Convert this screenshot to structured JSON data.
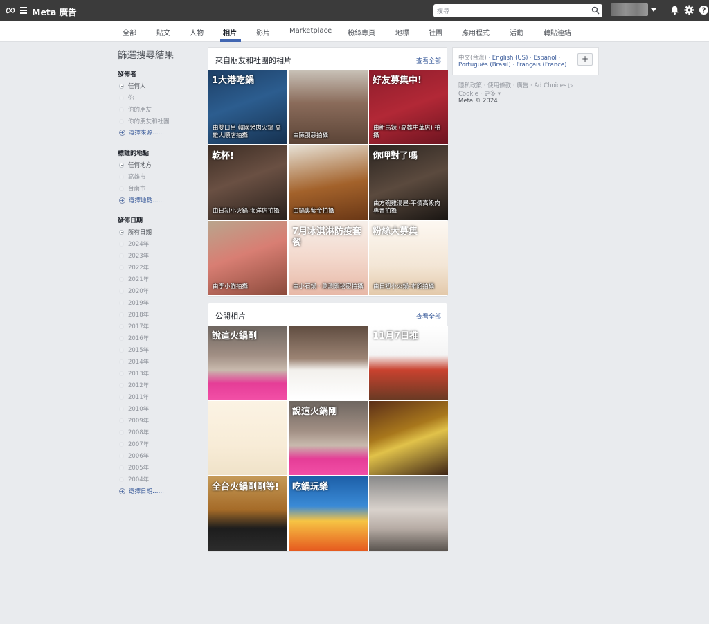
{
  "header": {
    "brand": "Meta 廣告",
    "search_placeholder": "搜尋",
    "icons": [
      "meta-logo-icon",
      "menu-icon",
      "search-icon",
      "bell-icon",
      "gear-icon",
      "help-icon"
    ]
  },
  "tabs": [
    "全部",
    "貼文",
    "人物",
    "相片",
    "影片",
    "Marketplace",
    "粉絲專頁",
    "地標",
    "社團",
    "應用程式",
    "活動",
    "轉貼連結"
  ],
  "active_tab": "相片",
  "filters": {
    "title": "篩選搜尋結果",
    "poster": {
      "heading": "發佈者",
      "options": [
        "任何人",
        "你",
        "你的朋友",
        "你的朋友和社團"
      ],
      "selected": "任何人",
      "more": "選擇來源……"
    },
    "location": {
      "heading": "標註的地點",
      "options": [
        "任何地方",
        "高雄市",
        "台南市"
      ],
      "selected": "任何地方",
      "more": "選擇地點……"
    },
    "date": {
      "heading": "發佈日期",
      "options": [
        "所有日期",
        "2024年",
        "2023年",
        "2022年",
        "2021年",
        "2020年",
        "2019年",
        "2018年",
        "2017年",
        "2016年",
        "2015年",
        "2014年",
        "2013年",
        "2012年",
        "2011年",
        "2010年",
        "2009年",
        "2008年",
        "2007年",
        "2006年",
        "2005年",
        "2004年"
      ],
      "selected": "所有日期",
      "more": "選擇日期……"
    }
  },
  "friends_section": {
    "title": "來自朋友和社團的相片",
    "see_all": "查看全部",
    "photos": [
      {
        "caption": "由雙口呂 韓國烤肉火鍋 高雄大順店拍攝",
        "overlay": "1大港吃鍋"
      },
      {
        "caption": "由陳韻慈拍攝",
        "overlay": ""
      },
      {
        "caption": "由新馬辣 (高雄中華店) 拍攝",
        "overlay": "好友募集中!"
      },
      {
        "caption": "由日初小火鍋-海洋店拍攝",
        "overlay": "乾杯!"
      },
      {
        "caption": "由鍋裏紫金拍攝",
        "overlay": ""
      },
      {
        "caption": "由方碗雞湯屋-平價高級肉專賣拍攝",
        "overlay": "你呷對了嗎"
      },
      {
        "caption": "由李小貓拍攝",
        "overlay": ""
      },
      {
        "caption": "由小石鍋 · 涮涮鍋秘密拍攝",
        "overlay": "7月冰淇淋防疫套餐"
      },
      {
        "caption": "由日初小火鍋-本館拍攝",
        "overlay": "粉絲大募集"
      }
    ]
  },
  "public_section": {
    "title": "公開相片",
    "see_all": "查看全部",
    "photos": [
      {
        "overlay": "說這火鍋剛"
      },
      {
        "overlay": ""
      },
      {
        "overlay": "11月7日推"
      },
      {
        "overlay": ""
      },
      {
        "overlay": "說這火鍋剛"
      },
      {
        "overlay": ""
      },
      {
        "overlay": "全台火鍋剛剛等!"
      },
      {
        "overlay": "吃鍋玩樂"
      },
      {
        "overlay": ""
      }
    ]
  },
  "languages": {
    "current": "中文(台灣)",
    "others": [
      "English (US)",
      "Español",
      "Português (Brasil)",
      "Français (France)"
    ],
    "add_label": "+"
  },
  "footer": {
    "links": [
      "隱私政策",
      "使用條款",
      "廣告",
      "Ad Choices",
      "Cookie",
      "更多"
    ],
    "copyright": "Meta © 2024"
  },
  "colors": {
    "topbar": "#3b3b3b",
    "link": "#365899",
    "accent": "#4267b2",
    "page_bg": "#e9ebee"
  }
}
